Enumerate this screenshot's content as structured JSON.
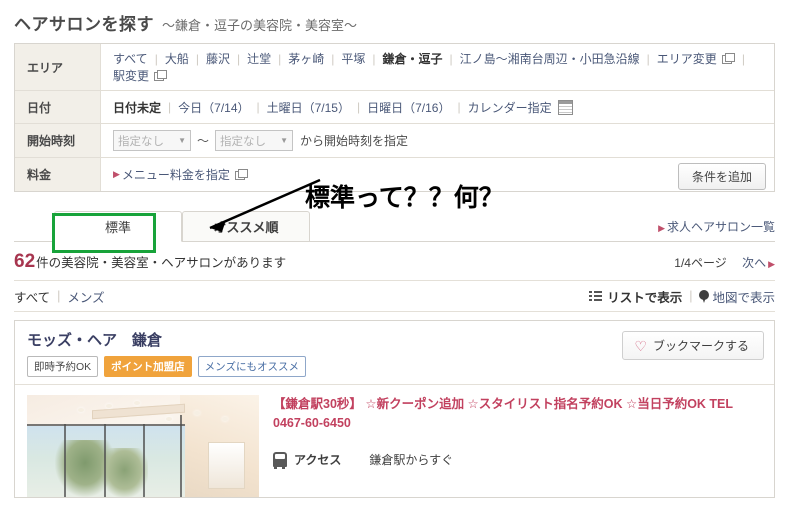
{
  "header": {
    "title": "ヘアサロンを探す",
    "subtitle": "〜鎌倉・逗子の美容院・美容室〜"
  },
  "search": {
    "area": {
      "label": "エリア",
      "options": [
        "すべて",
        "大船",
        "藤沢",
        "辻堂",
        "茅ヶ崎",
        "平塚",
        "鎌倉・逗子",
        "江ノ島〜湘南台周辺・小田急沿線"
      ],
      "selected": "鎌倉・逗子",
      "change_area_label": "エリア変更",
      "change_station_label": "駅変更"
    },
    "date": {
      "label": "日付",
      "options": [
        "日付未定",
        "今日（7/14）",
        "土曜日（7/15）",
        "日曜日（7/16）"
      ],
      "selected": "日付未定",
      "calendar_label": "カレンダー指定"
    },
    "start_time": {
      "label": "開始時刻",
      "from_value": "指定なし",
      "to_value": "指定なし",
      "tilde": "〜",
      "note": "から開始時刻を指定"
    },
    "fee": {
      "label": "料金",
      "menu_link": "メニュー料金を指定"
    },
    "add_condition_button": "条件を追加"
  },
  "annotation": {
    "text": "標準って？？何？",
    "highlight_color": "#18a33a"
  },
  "tabs": {
    "items": [
      {
        "label": "標準",
        "active": true
      },
      {
        "label": "オススメ順",
        "active": false
      }
    ],
    "job_salon_link": "求人ヘアサロン一覧"
  },
  "results": {
    "count": "62",
    "count_text": "件の美容院・美容室・ヘアサロンがあります",
    "page_indicator": "1/4ページ",
    "next_label": "次へ"
  },
  "filters": {
    "all": "すべて",
    "mens": "メンズ",
    "list_view": "リストで表示",
    "map_view": "地図で表示"
  },
  "salon": {
    "name": "モッズ・ヘア　鎌倉",
    "badges": [
      {
        "label": "即時予約OK",
        "style": "gray"
      },
      {
        "label": "ポイント加盟店",
        "style": "orange"
      },
      {
        "label": "メンズにもオススメ",
        "style": "blue"
      }
    ],
    "bookmark_label": "ブックマークする",
    "catchphrase": "【鎌倉駅30秒】 ☆新クーポン追加 ☆スタイリスト指名予約OK ☆当日予約OK TEL 0467-60-6450",
    "access_label": "アクセス",
    "access_value": "鎌倉駅からすぐ"
  }
}
